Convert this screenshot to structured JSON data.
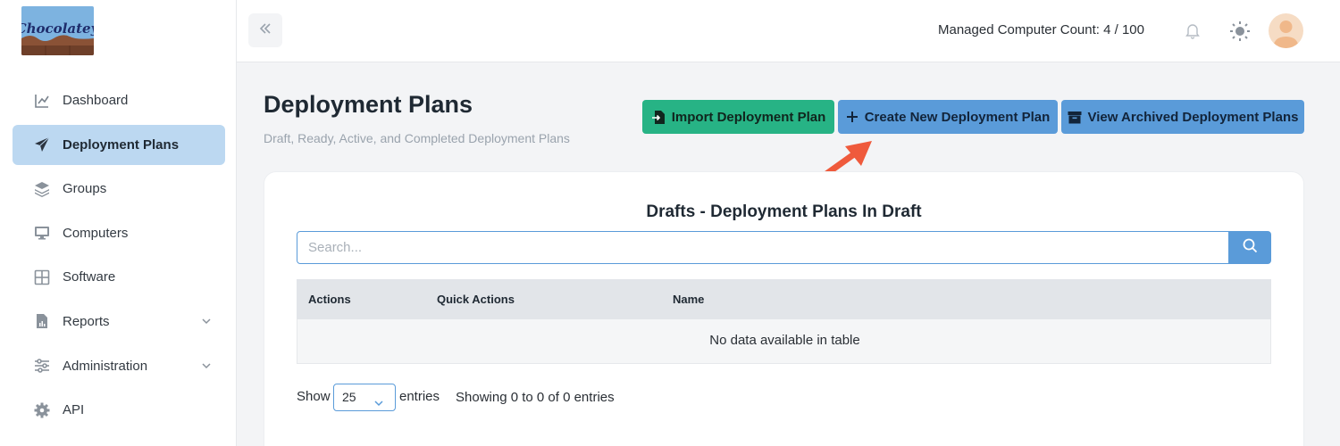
{
  "brand": {
    "logo_text": "Chocolatey"
  },
  "sidebar": {
    "items": [
      {
        "label": "Dashboard",
        "icon": "chart-line-icon"
      },
      {
        "label": "Deployment Plans",
        "icon": "paper-plane-icon",
        "active": true
      },
      {
        "label": "Groups",
        "icon": "layers-icon"
      },
      {
        "label": "Computers",
        "icon": "monitor-icon"
      },
      {
        "label": "Software",
        "icon": "grid-icon"
      },
      {
        "label": "Reports",
        "icon": "file-chart-icon",
        "expandable": true
      },
      {
        "label": "Administration",
        "icon": "sliders-icon",
        "expandable": true
      },
      {
        "label": "API",
        "icon": "gear-icon"
      }
    ]
  },
  "topbar": {
    "managed_count": "Managed Computer Count: 4 / 100"
  },
  "page": {
    "title": "Deployment Plans",
    "subtitle": "Draft, Ready, Active, and Completed Deployment Plans"
  },
  "actions": {
    "import": "Import Deployment Plan",
    "create": "Create New Deployment Plan",
    "archived": "View Archived Deployment Plans"
  },
  "table": {
    "title": "Drafts - Deployment Plans In Draft",
    "search_placeholder": "Search...",
    "columns": [
      "Actions",
      "Quick Actions",
      "Name"
    ],
    "empty": "No data available in table",
    "show_label": "Show",
    "page_size": "25",
    "entries_label": "entries",
    "info": "Showing 0 to 0 of 0 entries"
  },
  "colors": {
    "accent": "#5a9bd9",
    "green": "#27b385",
    "active_nav": "#bcd8f1",
    "annotation_arrow": "#ef5a3c"
  }
}
